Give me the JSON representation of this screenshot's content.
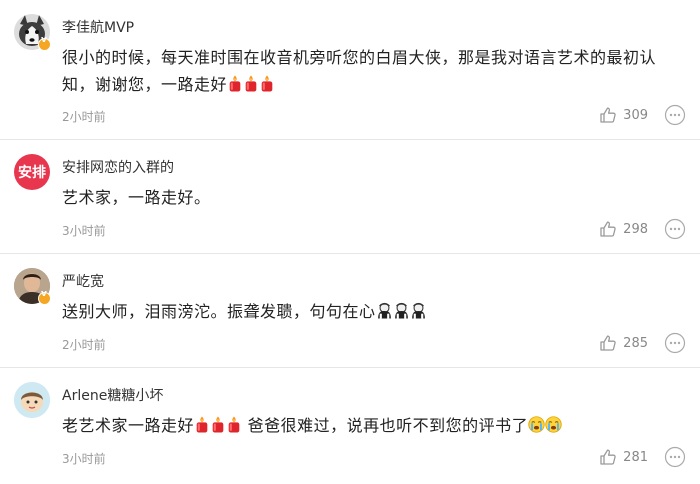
{
  "comments": [
    {
      "username": "李佳航MVP",
      "text": "很小的时候，每天准时围在收音机旁听您的白眉大侠，那是我对语言艺术的最初认知，谢谢您，一路走好",
      "time": "2小时前",
      "likes": "309",
      "trailing_emoji": "candle-icon x3",
      "avatar": "husky-dog-avatar"
    },
    {
      "username": "安排网恋的入群的",
      "avatar_text": "安排",
      "text": "艺术家，一路走好。",
      "time": "3小时前",
      "likes": "298",
      "avatar_color": "#e8364f"
    },
    {
      "username": "严屹宽",
      "text": "送别大师，泪雨滂沱。振聋发聩，句句在心",
      "time": "2小时前",
      "likes": "285",
      "trailing_emoji": "bow-icon x3",
      "avatar": "man-portrait-avatar"
    },
    {
      "username": "Arlene糖糖小坏",
      "text_part1": "老艺术家一路走好",
      "text_part2": " 爸爸很难过，说再也听不到您的评书了",
      "time": "3小时前",
      "likes": "281",
      "emoji_1": "candle-icon x3",
      "emoji_2": "crying-icon x2",
      "avatar": "cartoon-avatar"
    }
  ],
  "colors": {
    "meta_text": "#999999",
    "divider": "#e6e6e6",
    "badge": "#f5a623"
  }
}
